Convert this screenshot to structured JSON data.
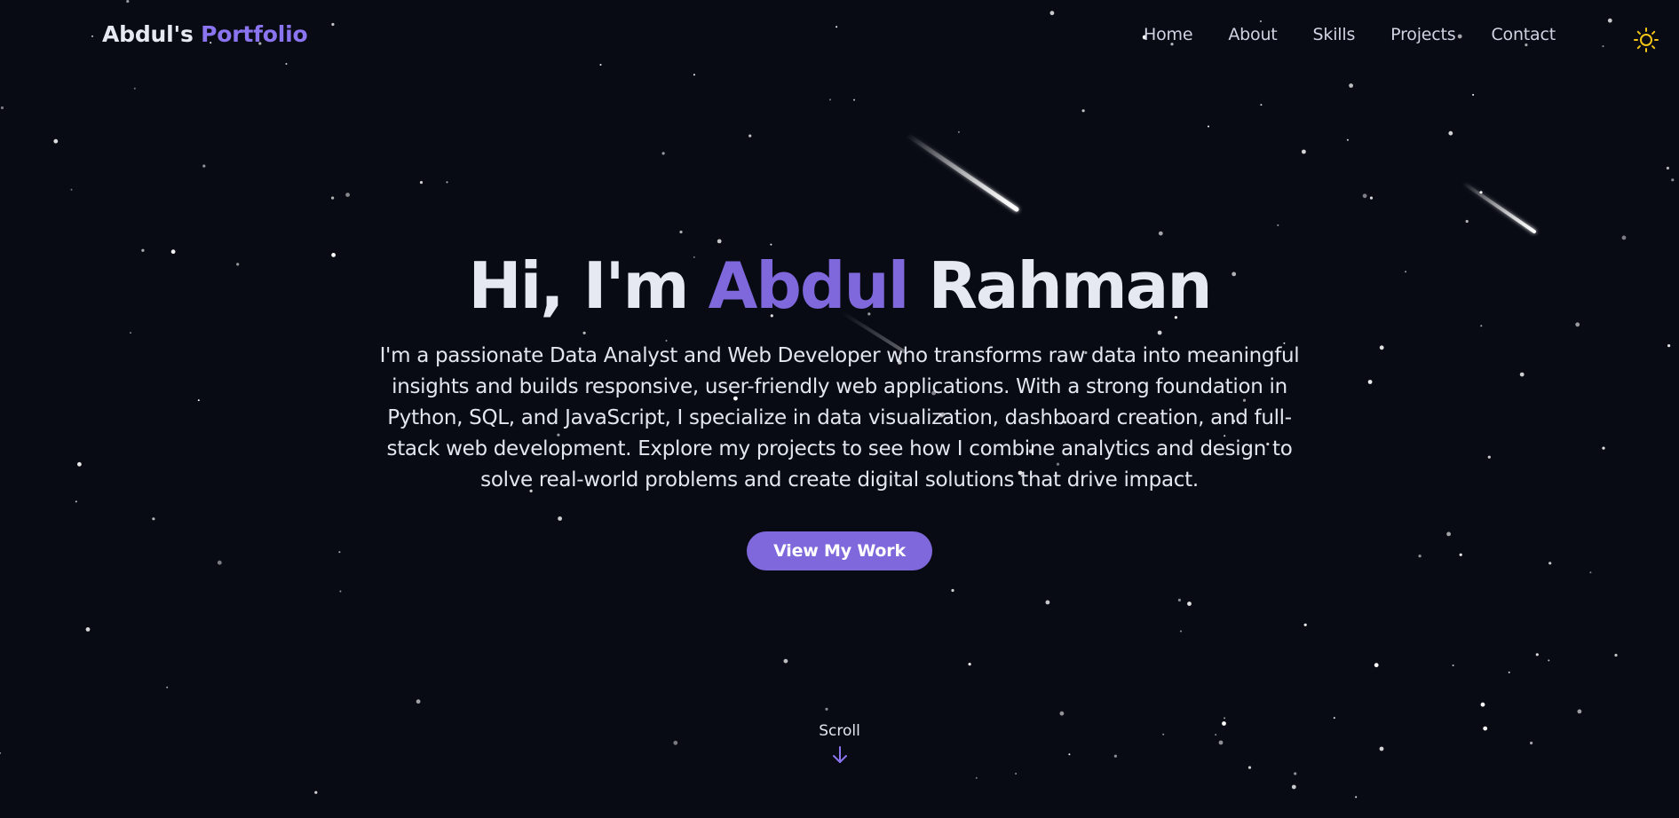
{
  "nav": {
    "logo_main": "Abdul's",
    "logo_accent": "Portfolio",
    "links": [
      "Home",
      "About",
      "Skills",
      "Projects",
      "Contact"
    ],
    "theme_icon": "sun-icon"
  },
  "hero": {
    "greeting": "Hi, I'm",
    "first_name": "Abdul",
    "last_name": "Rahman",
    "bio": "I'm a passionate Data Analyst and Web Developer who transforms raw data into meaningful insights and builds responsive, user-friendly web applications. With a strong foundation in Python, SQL, and JavaScript, I specialize in data visualization, dashboard creation, and full-stack web development. Explore my projects to see how I combine analytics and design to solve real-world problems and create digital solutions that drive impact.",
    "cta_label": "View My Work"
  },
  "scroll": {
    "label": "Scroll",
    "icon": "arrow-down-icon"
  },
  "colors": {
    "background": "#080b14",
    "accent": "#7f68dc",
    "accent_light": "#8b74f0",
    "text": "#e6e8f2",
    "sun": "#f5c518"
  }
}
